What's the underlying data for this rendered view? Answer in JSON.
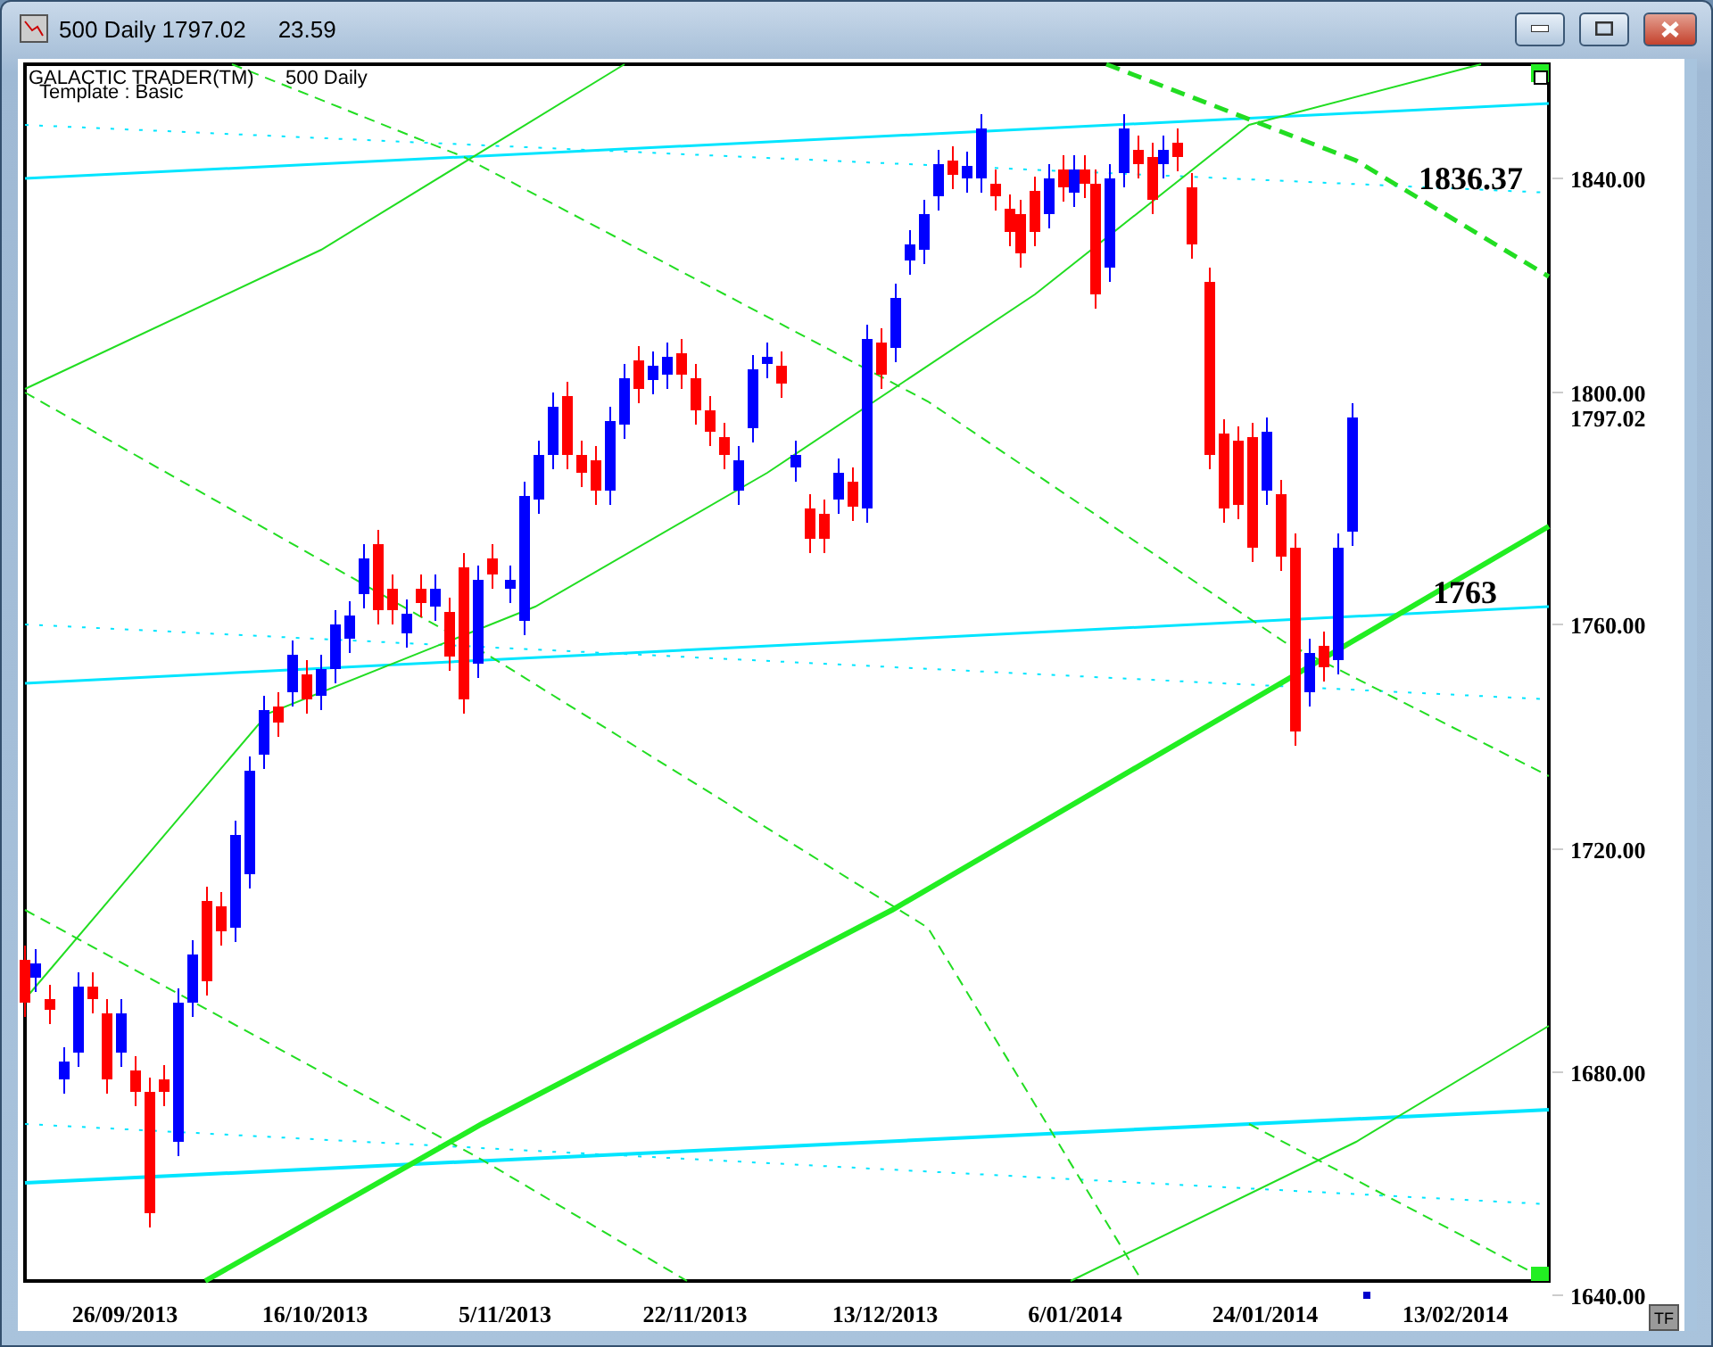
{
  "window": {
    "title": "500 Daily 1797.02",
    "reading": "23.59"
  },
  "chart": {
    "header": "GALACTIC TRADER(TM)",
    "instrument": "500 Daily",
    "template": "Template : Basic",
    "callouts": [
      {
        "text": "1836.37",
        "kind": "upper"
      },
      {
        "text": "1763",
        "kind": "lower"
      }
    ],
    "price_labels": [
      {
        "text": "1840.00",
        "kind": "tick"
      },
      {
        "text": "1800.00",
        "kind": "tick"
      },
      {
        "text": "1797.02",
        "kind": "last"
      },
      {
        "text": "1760.00",
        "kind": "tick"
      },
      {
        "text": "1720.00",
        "kind": "tick"
      },
      {
        "text": "1680.00",
        "kind": "tick"
      },
      {
        "text": "1640.00",
        "kind": "tick"
      }
    ],
    "date_labels": [
      "26/09/2013",
      "16/10/2013",
      "5/11/2013",
      "22/11/2013",
      "13/12/2013",
      "6/01/2014",
      "24/01/2014",
      "13/02/2014"
    ],
    "tf_button": "TF"
  }
}
